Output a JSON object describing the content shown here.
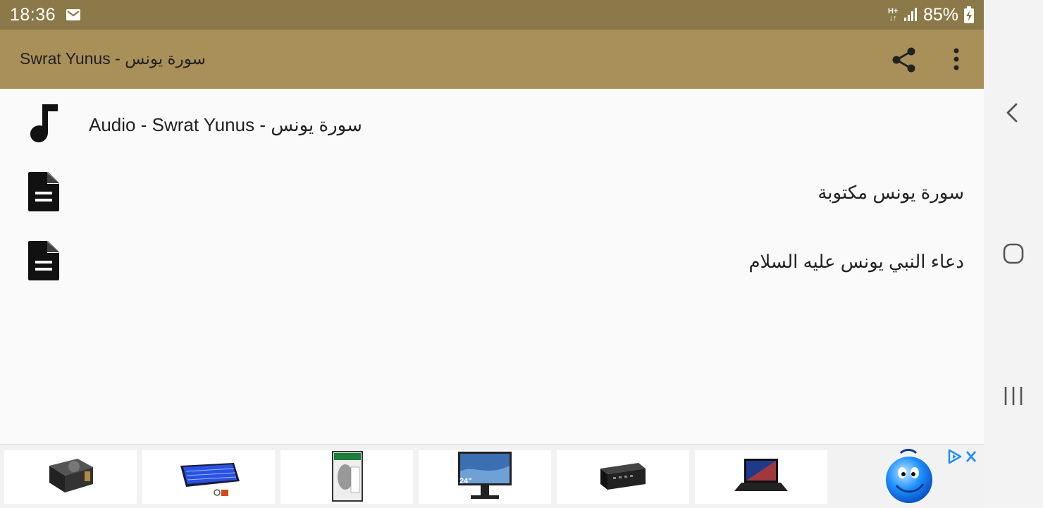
{
  "status_bar": {
    "time": "18:36",
    "network": "H+",
    "battery": "85%"
  },
  "app_bar": {
    "title": "Swrat Yunus -  سورة يونس",
    "share_icon": "share-icon",
    "more_icon": "more-vert-icon"
  },
  "list": [
    {
      "icon": "music-note-icon",
      "label": "Audio -  Swrat Yunus - سورة يونس"
    },
    {
      "icon": "document-icon",
      "label": "سورة يونس مكتوبة"
    },
    {
      "icon": "document-icon",
      "label": "دعاء النبي يونس عليه السلام"
    }
  ],
  "nav_bar": {
    "back_icon": "back-icon",
    "home_icon": "home-icon",
    "recents_icon": "recents-icon"
  },
  "ad_banner": {
    "products": [
      {
        "icon": "power-supply-icon"
      },
      {
        "icon": "keyboard-icon"
      },
      {
        "icon": "hard-drive-icon"
      },
      {
        "icon": "monitor-icon",
        "text": "24\""
      },
      {
        "icon": "speaker-icon"
      },
      {
        "icon": "laptop-icon"
      }
    ],
    "mascot_icon": "smiley-mascot-icon",
    "adchoices_icon": "adchoices-icon",
    "close_icon": "close-icon"
  }
}
